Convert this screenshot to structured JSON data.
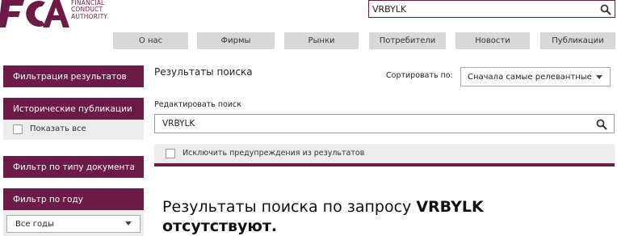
{
  "brand": {
    "logo_text": "FCA",
    "name_lines": [
      "FINANCIAL",
      "CONDUCT",
      "AUTHORITY"
    ],
    "color": "#6e1a46"
  },
  "header_search": {
    "value": "VRBYLK",
    "icon": "search-icon"
  },
  "nav": [
    "О нас",
    "Фирмы",
    "Рынки",
    "Потребители",
    "Новости",
    "Публикации"
  ],
  "sidebar": {
    "filter_results": "Фильтрация результатов",
    "historical": "Исторические публикации",
    "show_all": "Показать все",
    "doc_type": "Фильтр по типу документа",
    "by_year": "Фильтр по году",
    "years_value": "Все годы"
  },
  "main": {
    "title": "Результаты поиска",
    "sort_label": "Сортировать по:",
    "sort_value": "Сначала самые релевантные",
    "edit_label": "Редактировать поиск",
    "search_value": "VRBYLK",
    "exclude_label": "Исключить предупреждения из результатов",
    "no_results_prefix": "Результаты поиска по запросу",
    "no_results_query": "VRBYLK",
    "no_results_suffix": "отсутствуют."
  }
}
